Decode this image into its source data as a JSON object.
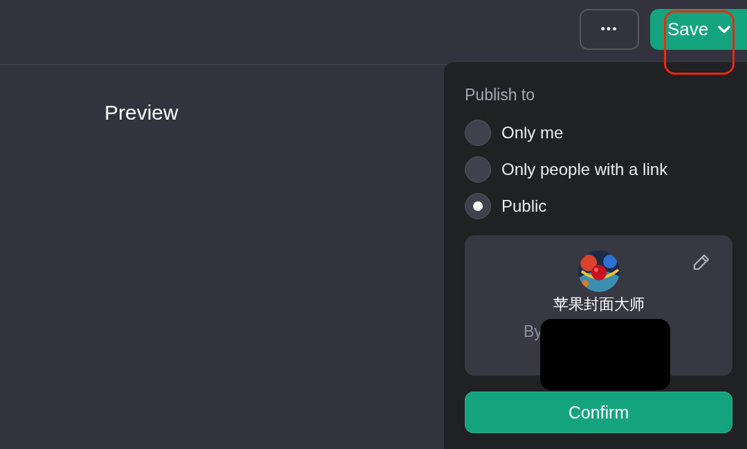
{
  "toolbar": {
    "more_button": "•••",
    "save_button": "Save"
  },
  "preview": {
    "title": "Preview"
  },
  "publish_menu": {
    "heading": "Publish to",
    "options": [
      {
        "label": "Only me",
        "selected": false
      },
      {
        "label": "Only people with a link",
        "selected": false
      },
      {
        "label": "Public",
        "selected": true
      }
    ],
    "card": {
      "name": "苹果封面大师",
      "byline": "By"
    },
    "confirm_button": "Confirm"
  }
}
